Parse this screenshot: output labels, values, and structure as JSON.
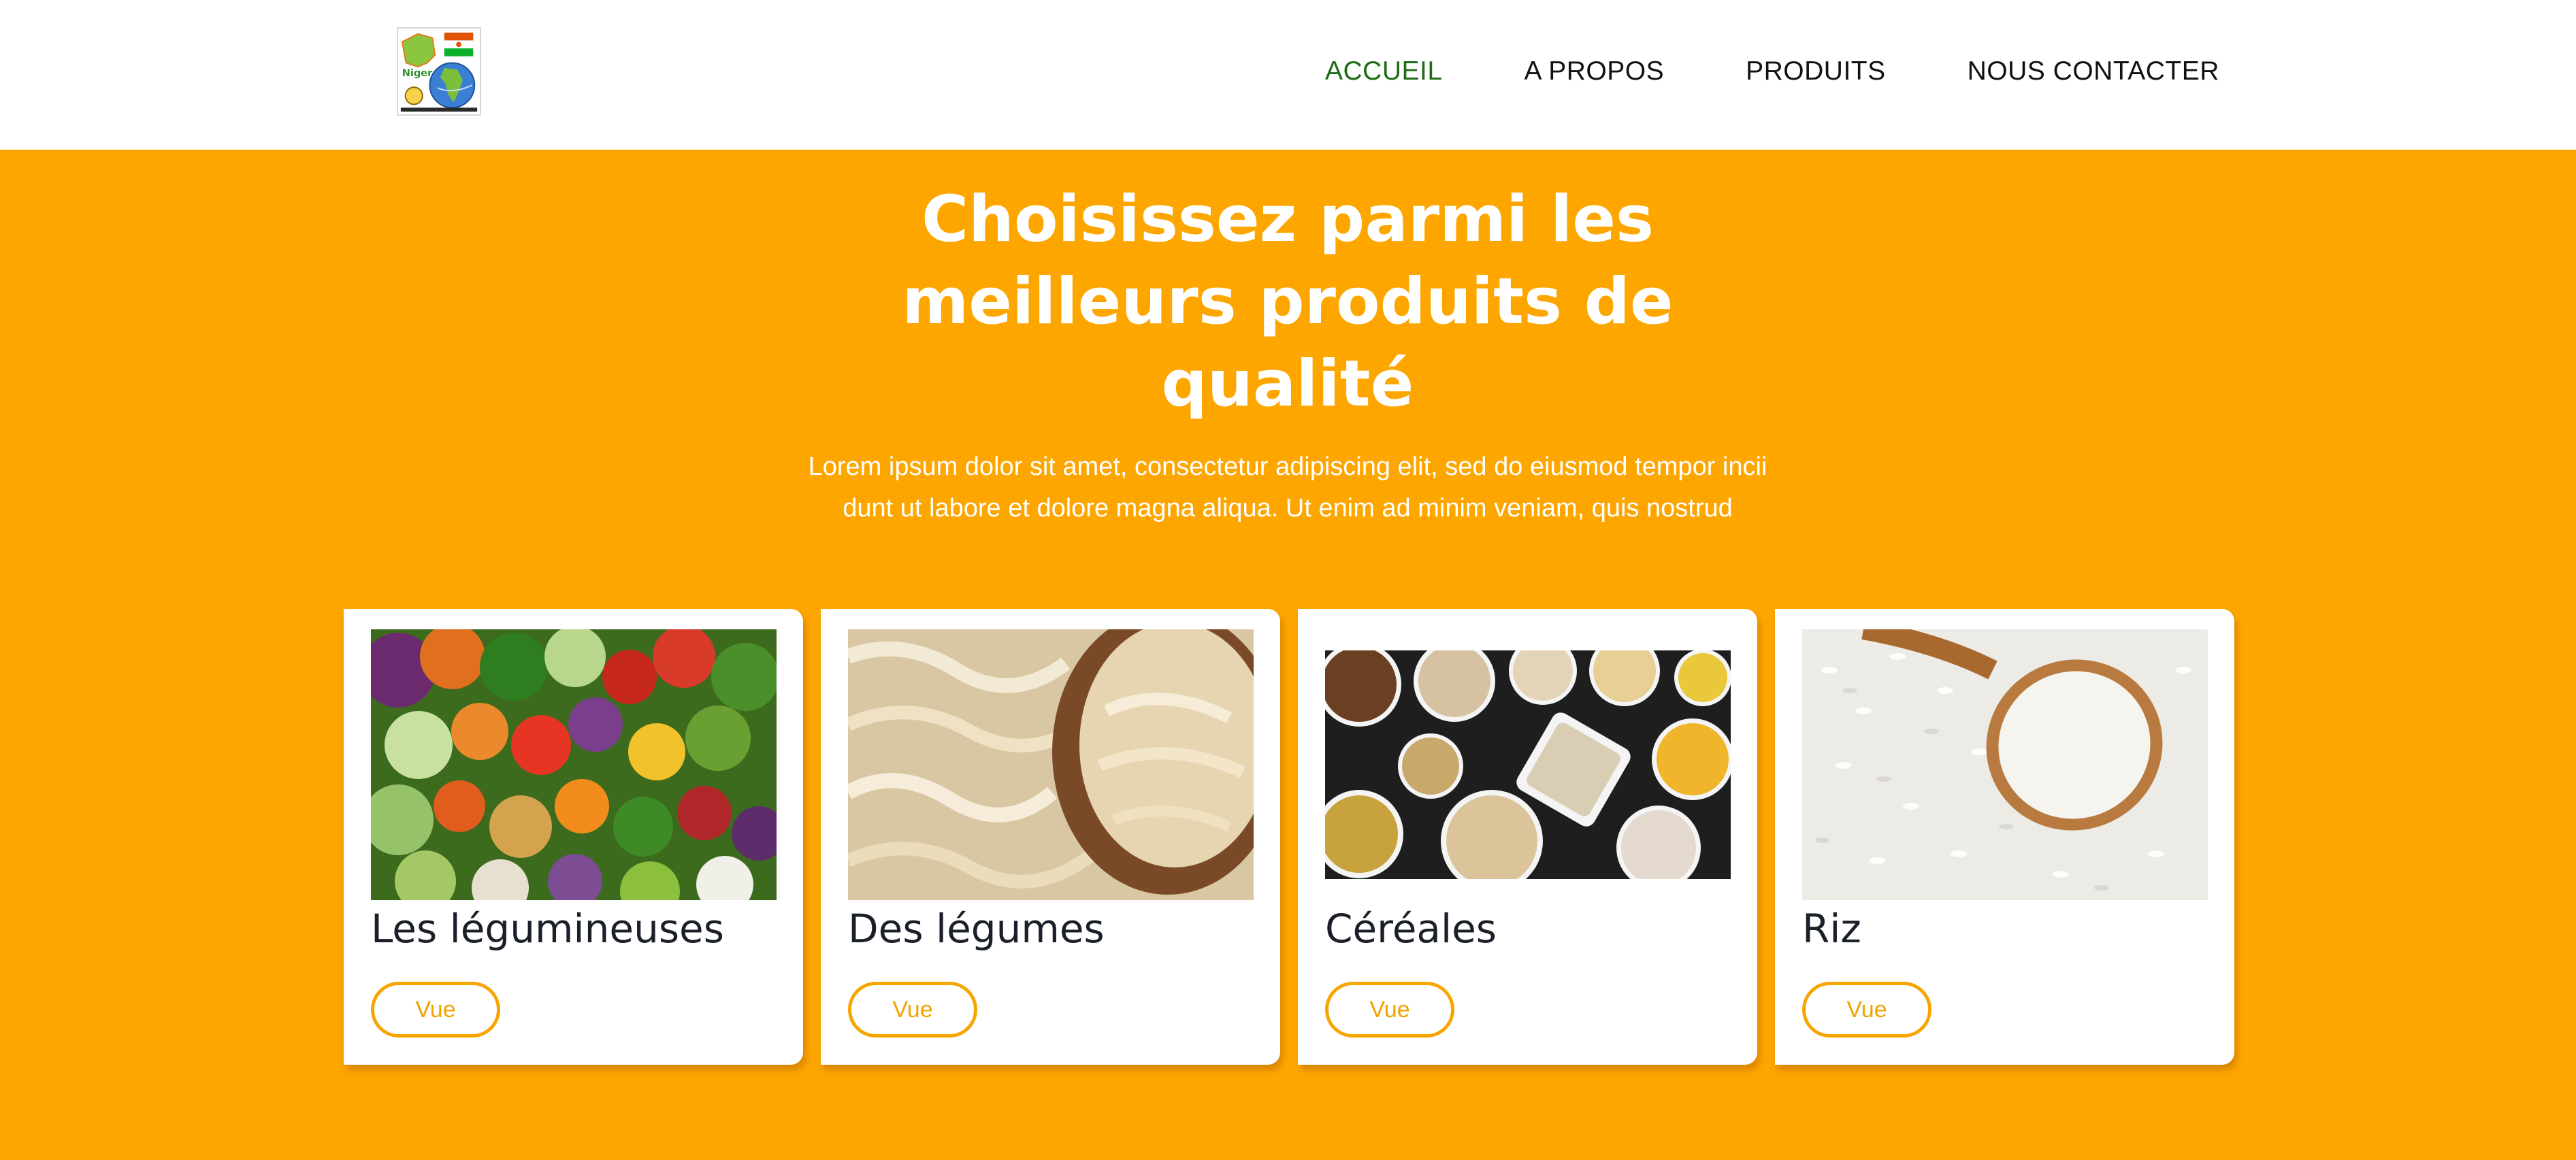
{
  "header": {
    "logo_text": "Niger",
    "nav": [
      {
        "label": "ACCUEIL",
        "active": true
      },
      {
        "label": "A PROPOS",
        "active": false
      },
      {
        "label": "PRODUITS",
        "active": false
      },
      {
        "label": "NOUS CONTACTER",
        "active": false
      }
    ]
  },
  "hero": {
    "title_lines": [
      "Choisissez parmi les",
      "meilleurs produits de",
      "qualité"
    ],
    "text_lines": [
      "Lorem ipsum dolor sit amet, consectetur adipiscing elit, sed do eiusmod tempor incii",
      "dunt ut labore et dolore magna aliqua. Ut enim ad minim veniam, quis nostrud"
    ]
  },
  "cards": [
    {
      "title": "Les légumineuses",
      "button": "Vue",
      "image": "vegetables-photo"
    },
    {
      "title": "Des légumes",
      "button": "Vue",
      "image": "dried-cabbage-photo"
    },
    {
      "title": "Céréales",
      "button": "Vue",
      "image": "cereal-bowls-photo"
    },
    {
      "title": "Riz",
      "button": "Vue",
      "image": "rice-spoon-photo"
    }
  ],
  "colors": {
    "background": "#fea600",
    "accent": "#f7a500",
    "nav_active": "#1f6b16",
    "text_dark": "#1a1f29"
  }
}
